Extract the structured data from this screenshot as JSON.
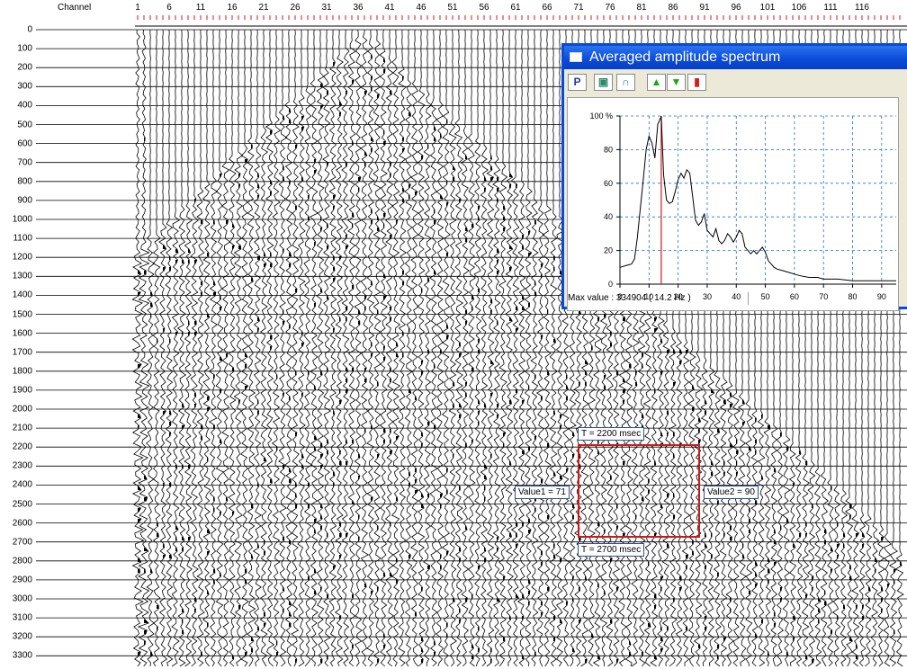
{
  "header": {
    "channel_label": "Channel",
    "channel_ticks": [
      "1",
      "6",
      "11",
      "16",
      "21",
      "26",
      "31",
      "36",
      "41",
      "46",
      "51",
      "56",
      "61",
      "66",
      "71",
      "76",
      "81",
      "86",
      "91",
      "96",
      "101",
      "106",
      "111",
      "116"
    ]
  },
  "time_axis": {
    "labels": [
      "0",
      "100",
      "200",
      "300",
      "400",
      "500",
      "600",
      "700",
      "800",
      "900",
      "1000",
      "1100",
      "1200",
      "1300",
      "1400",
      "1500",
      "1600",
      "1700",
      "1800",
      "1900",
      "2000",
      "2100",
      "2200",
      "2300",
      "2400",
      "2500",
      "2600",
      "2700",
      "2800",
      "2900",
      "3000",
      "3100",
      "3200",
      "3300"
    ]
  },
  "markers": {
    "t_top": "T = 2200 msec",
    "t_bottom": "T = 2700 msec",
    "value1": "Value1 = 71",
    "value2": "Value2 = 90"
  },
  "colors": {
    "selection": "#cc1a1a",
    "title_bar": "#0a4ad6",
    "grid": "#1e6fd9",
    "marker_line": "#cc1a1a"
  },
  "spectrum_window": {
    "title": "Averaged amplitude spectrum",
    "toolbar": {
      "buttons": [
        {
          "name": "print-button",
          "icon": "p-icon",
          "glyph": "P"
        },
        {
          "name": "zoom-fit-button",
          "icon": "zoom-fit-icon",
          "glyph": "▣"
        },
        {
          "name": "smooth-button",
          "icon": "bell-curve-icon",
          "glyph": "∩"
        },
        {
          "name": "scale-up-button",
          "icon": "triangle-up-icon",
          "glyph": "▲"
        },
        {
          "name": "scale-down-button",
          "icon": "triangle-down-icon",
          "glyph": "▼"
        },
        {
          "name": "bar-chart-button",
          "icon": "bar-chart-icon",
          "glyph": "▮"
        }
      ]
    },
    "status": "Max value : 334904  ( 14.2 Hz )",
    "chart": {
      "y_ticks": [
        "0",
        "20",
        "40",
        "60",
        "80",
        "100 %"
      ],
      "x_ticks": [
        "0",
        "10",
        "20",
        "30",
        "40",
        "50",
        "60",
        "70",
        "80",
        "90"
      ]
    }
  },
  "chart_data": {
    "type": "line",
    "title": "",
    "xlabel": "",
    "ylabel": "",
    "xlim": [
      0,
      95
    ],
    "ylim": [
      0,
      100
    ],
    "grid": true,
    "marker_x": 14.2,
    "x": [
      0,
      2,
      4,
      5,
      6,
      7,
      8,
      9,
      10,
      11,
      12,
      13,
      14,
      14.2,
      15,
      16,
      17,
      18,
      19,
      20,
      21,
      22,
      23,
      24,
      25,
      26,
      27,
      28,
      29,
      30,
      31,
      32,
      33,
      34,
      35,
      36,
      37,
      38,
      39,
      40,
      41,
      42,
      43,
      44,
      45,
      46,
      47,
      48,
      49,
      50,
      51,
      52,
      53,
      54,
      56,
      58,
      60,
      62,
      65,
      68,
      70,
      75,
      80,
      85,
      90,
      95
    ],
    "y": [
      10,
      11,
      12,
      15,
      28,
      45,
      62,
      80,
      88,
      84,
      75,
      95,
      99,
      100,
      65,
      50,
      48,
      49,
      55,
      62,
      66,
      63,
      68,
      66,
      52,
      38,
      35,
      37,
      42,
      32,
      30,
      28,
      33,
      26,
      24,
      26,
      30,
      28,
      25,
      28,
      32,
      30,
      22,
      20,
      18,
      20,
      18,
      20,
      22,
      19,
      14,
      12,
      10,
      9,
      8,
      7,
      6,
      5,
      4,
      4,
      3,
      3,
      2,
      2,
      2,
      2
    ]
  }
}
